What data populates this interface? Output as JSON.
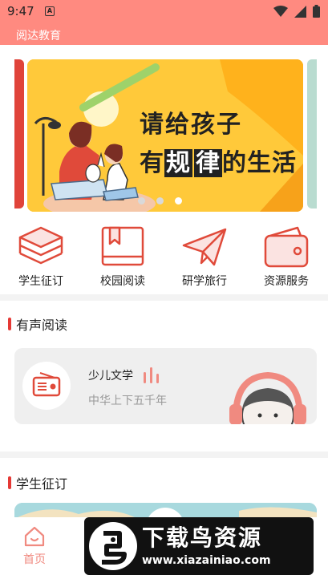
{
  "status_bar": {
    "time": "9:47",
    "notification_letter": "A",
    "icons": [
      "wifi-icon",
      "signal-icon",
      "battery-icon"
    ]
  },
  "app": {
    "title": "阅达教育"
  },
  "banner": {
    "line1": "请给孩子",
    "line2_prefix": "有",
    "line2_box1": "规",
    "line2_box2": "律",
    "line2_suffix": "的生活",
    "slide_count": 3,
    "active_slide": 3
  },
  "menu": [
    {
      "label": "学生征订",
      "icon": "layers-icon"
    },
    {
      "label": "校园阅读",
      "icon": "book-icon"
    },
    {
      "label": "研学旅行",
      "icon": "paper-plane-icon"
    },
    {
      "label": "资源服务",
      "icon": "wallet-icon"
    }
  ],
  "audio_section": {
    "title": "有声阅读",
    "card": {
      "name": "少儿文学",
      "subtitle": "中华上下五千年"
    }
  },
  "student_section": {
    "title": "学生征订"
  },
  "tabbar": {
    "home_label": "首页"
  },
  "watermark": {
    "title": "下载鸟资源",
    "url": "www.xiazainiao.com"
  },
  "colors": {
    "primary": "#ff8a80",
    "accent_red": "#e53935",
    "banner_yellow": "#ffc93a"
  }
}
